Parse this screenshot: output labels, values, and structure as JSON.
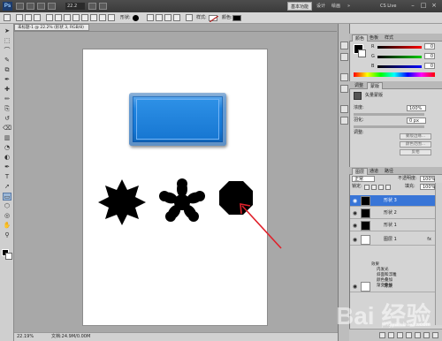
{
  "menubar": {
    "app_logo": "Ps",
    "items": [
      "文件(F)",
      "编辑(E)",
      "图像(I)",
      "图层(L)",
      "选择(S)",
      "滤镜(T)",
      "分析(A)",
      "3D(D)",
      "视图(V)",
      "窗口(W)",
      "帮助(H)"
    ],
    "zoom": "22.2",
    "workspace_active": "基本功能",
    "workspace_links": [
      "设计",
      "绘画"
    ],
    "cs_live": "CS Live",
    "window_buttons": [
      "–",
      "□",
      "×"
    ]
  },
  "optbar": {
    "style_label": "样式:",
    "color_label": "颜色:",
    "color_value": "#000000",
    "style_value": "#b32424"
  },
  "document": {
    "tab_title": "未标题-1 @ 22.2% (形状 3, RGB/8)",
    "status_zoom": "22.19%",
    "status_doc": "文档:24.9M/0.00M"
  },
  "tools": [
    "move-tool",
    "marquee-tool",
    "lasso-tool",
    "quick-select-tool",
    "crop-tool",
    "eyedropper-tool",
    "healing-tool",
    "brush-tool",
    "clone-tool",
    "history-brush-tool",
    "eraser-tool",
    "gradient-tool",
    "blur-tool",
    "dodge-tool",
    "pen-tool",
    "type-tool",
    "path-select-tool",
    "shape-tool",
    "3d-tool",
    "3d-camera-tool",
    "hand-tool",
    "zoom-tool"
  ],
  "colors": {
    "foreground": "#000000",
    "background": "#ffffff",
    "button_blue": "#1f83df",
    "arrow_red": "#e0202a",
    "selection_blue": "#3875d7"
  },
  "color_panel": {
    "tabs": [
      "颜色",
      "色板",
      "样式"
    ],
    "channels": [
      {
        "letter": "R",
        "value": "0"
      },
      {
        "letter": "G",
        "value": "0"
      },
      {
        "letter": "B",
        "value": "0"
      }
    ]
  },
  "adjust_panel": {
    "tabs": [
      "调整",
      "蒙版"
    ],
    "header": "矢量蒙版",
    "density_label": "浓度:",
    "density_value": "100%",
    "feather_label": "羽化:",
    "feather_value": "0 px",
    "refine_label": "调整:",
    "buttons": [
      "蒙版边缘...",
      "颜色范围...",
      "反相"
    ]
  },
  "layers_panel": {
    "tabs": [
      "图层",
      "通道",
      "路径"
    ],
    "blend_mode": "正常",
    "opacity_label": "不透明度:",
    "opacity_value": "100%",
    "lock_label": "锁定:",
    "fill_label": "填充:",
    "fill_value": "100%",
    "layers": [
      {
        "name": "形状 3",
        "selected": true,
        "thumb": "black"
      },
      {
        "name": "形状 2",
        "selected": false,
        "thumb": "black"
      },
      {
        "name": "形状 1",
        "selected": false,
        "thumb": "black"
      },
      {
        "name": "图层 1",
        "selected": false,
        "thumb": "white",
        "fx": true
      },
      {
        "name": "背景",
        "selected": false,
        "thumb": "white"
      }
    ],
    "effects_title": "效果",
    "effects": [
      "内发光",
      "斜面和浮雕",
      "颜色叠加",
      "渐变叠加"
    ]
  },
  "watermark": {
    "text": "Bai 经验",
    "sub": "jingyan.baidu.com"
  }
}
